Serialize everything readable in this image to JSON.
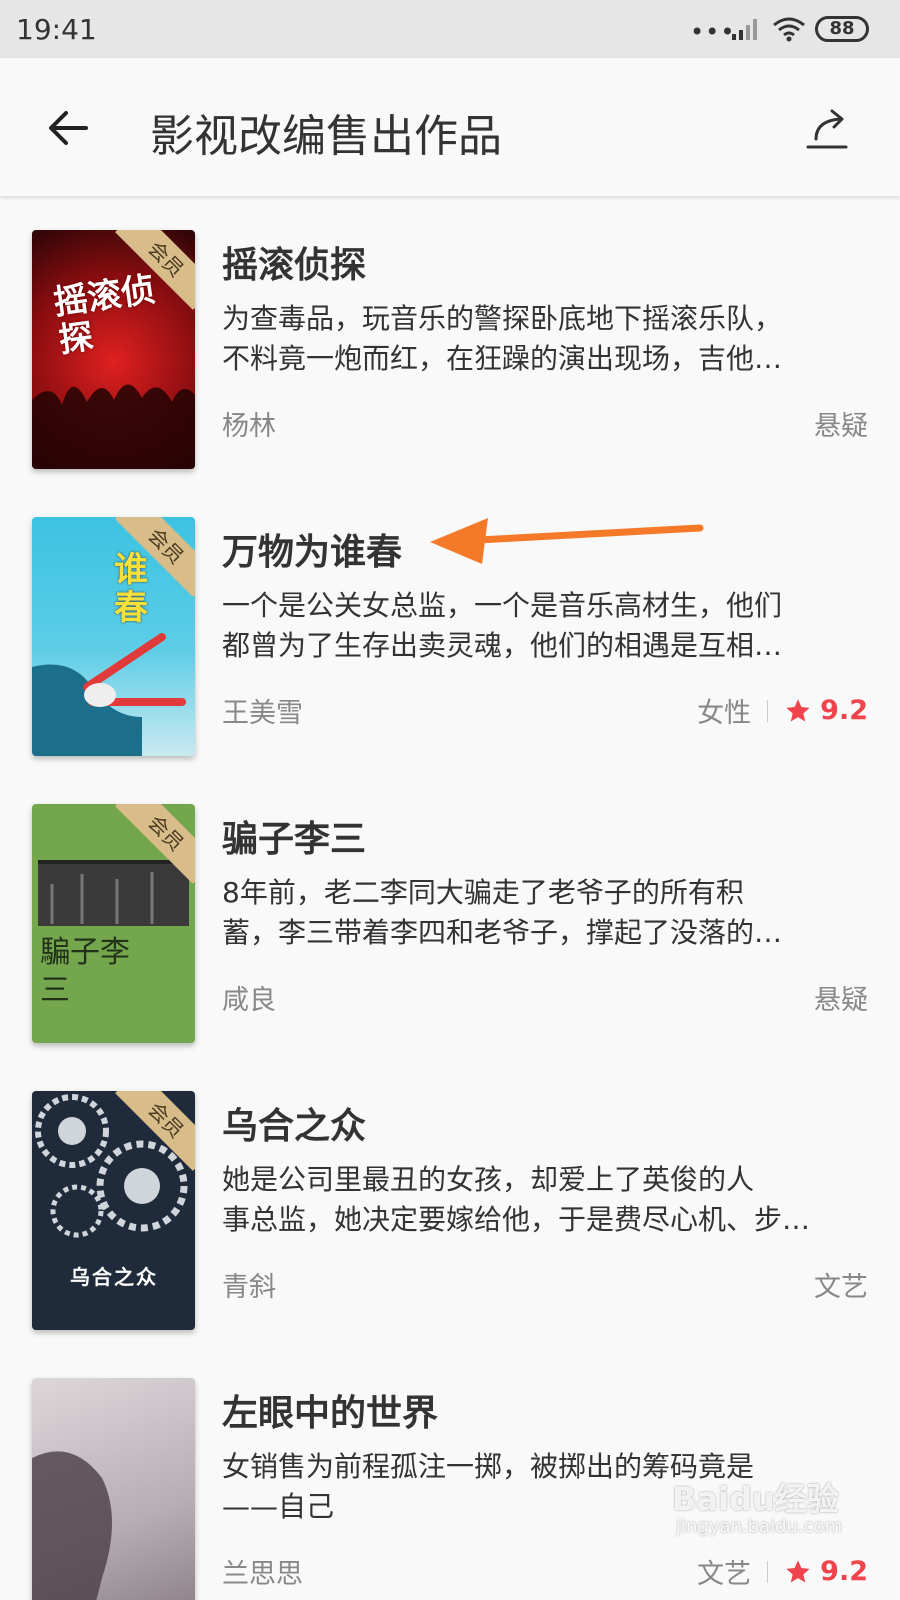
{
  "status_bar": {
    "time": "19:41",
    "dots": "•••",
    "battery": "88"
  },
  "app_bar": {
    "title": "影视改编售出作品"
  },
  "badge_label": "会员",
  "books": [
    {
      "title": "摇滚侦探",
      "desc_line1": "为查毒品，玩音乐的警探卧底地下摇滚乐队，",
      "desc_line2": "不料竟一炮而红，在狂躁的演出现场，吉他…",
      "author": "杨林",
      "genre": "悬疑",
      "rating": "",
      "cover_text": "摇滚侦探",
      "cover_color": "#9a1418"
    },
    {
      "title": "万物为谁春",
      "desc_line1": "一个是公关女总监，一个是音乐高材生，他们",
      "desc_line2": "都曾为了生存出卖灵魂，他们的相遇是互相…",
      "author": "王美雪",
      "genre": "女性",
      "rating": "9.2",
      "cover_text": "谁春",
      "cover_color": "#2bb6d8"
    },
    {
      "title": "骗子李三",
      "desc_line1": "8年前，老二李同大骗走了老爷子的所有积",
      "desc_line2": "蓄，李三带着李四和老爷子，撑起了没落的…",
      "author": "咸良",
      "genre": "悬疑",
      "rating": "",
      "cover_text": "騙子李三",
      "cover_color": "#74a64e"
    },
    {
      "title": "乌合之众",
      "desc_line1": "她是公司里最丑的女孩，却爱上了英俊的人",
      "desc_line2": "事总监，她决定要嫁给他，于是费尽心机、步…",
      "author": "青斜",
      "genre": "文艺",
      "rating": "",
      "cover_text": "乌合之众",
      "cover_color": "#1f2b3a"
    },
    {
      "title": "左眼中的世界",
      "desc_line1": "女销售为前程孤注一掷，被掷出的筹码竟是",
      "desc_line2": "——自己",
      "author": "兰思思",
      "genre": "文艺",
      "rating": "9.2",
      "cover_text": "",
      "cover_color": "#c9c2c6"
    }
  ],
  "watermark": {
    "text": "Baidu经验",
    "sub": "jingyan.baidu.com"
  },
  "colors": {
    "accent_rating": "#f0444c",
    "annotation_arrow": "#f47a2a"
  }
}
